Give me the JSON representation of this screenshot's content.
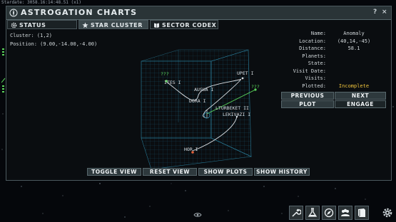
{
  "stardate": "Stardate: 3058.16:14:48.51 (x1)",
  "window": {
    "title": "ASTROGATION CHARTS",
    "help_label": "?",
    "close_label": "×"
  },
  "tabs": [
    {
      "label": "STATUS",
      "icon": "gear-icon"
    },
    {
      "label": "STAR CLUSTER",
      "icon": "star-icon"
    },
    {
      "label": "SECTOR CODEX",
      "icon": "book-icon"
    }
  ],
  "cluster": {
    "cluster_text": "Cluster: (1,2)",
    "position_text": "Position: (9.00,-14.00,-4.00)"
  },
  "plot_labels": {
    "unknown_1": "???",
    "unknown_2": "???",
    "ites": "ITES I",
    "ausua": "AUSUA I",
    "upet": "UPET I",
    "dora": "DORA I",
    "lturbekt": "LTURBEKET II",
    "lekivazi": "LEKIVAZI I",
    "hor": "HOR I"
  },
  "details": {
    "rows": [
      {
        "label": "Name:",
        "value": "Anomaly"
      },
      {
        "label": "Location:",
        "value": "(40,14,-45)"
      },
      {
        "label": "Distance:",
        "value": "58.1"
      },
      {
        "label": "Planets:",
        "value": ""
      },
      {
        "label": "State:",
        "value": ""
      },
      {
        "label": "Visit Date:",
        "value": ""
      },
      {
        "label": "Visits:",
        "value": ""
      },
      {
        "label": "Plotted:",
        "value": "Incomplete"
      }
    ],
    "plotted_color": "#f0c43c"
  },
  "nav_buttons": {
    "previous": "PREVIOUS",
    "next": "NEXT",
    "plot": "PLOT",
    "engage": "ENGAGE"
  },
  "bottom_buttons": {
    "toggle_view": "TOGGLE VIEW",
    "reset_view": "RESET VIEW",
    "show_plots": "SHOW PLOTS",
    "show_history": "SHOW HISTORY"
  },
  "dock": [
    "wrench-icon",
    "flask-icon",
    "compass-icon",
    "crew-icon",
    "book-icon",
    "settings-gear-icon"
  ],
  "colors": {
    "accent_green": "#5bd65b",
    "warn_yellow": "#f0c43c",
    "grid_cyan": "#2f8fb0"
  }
}
